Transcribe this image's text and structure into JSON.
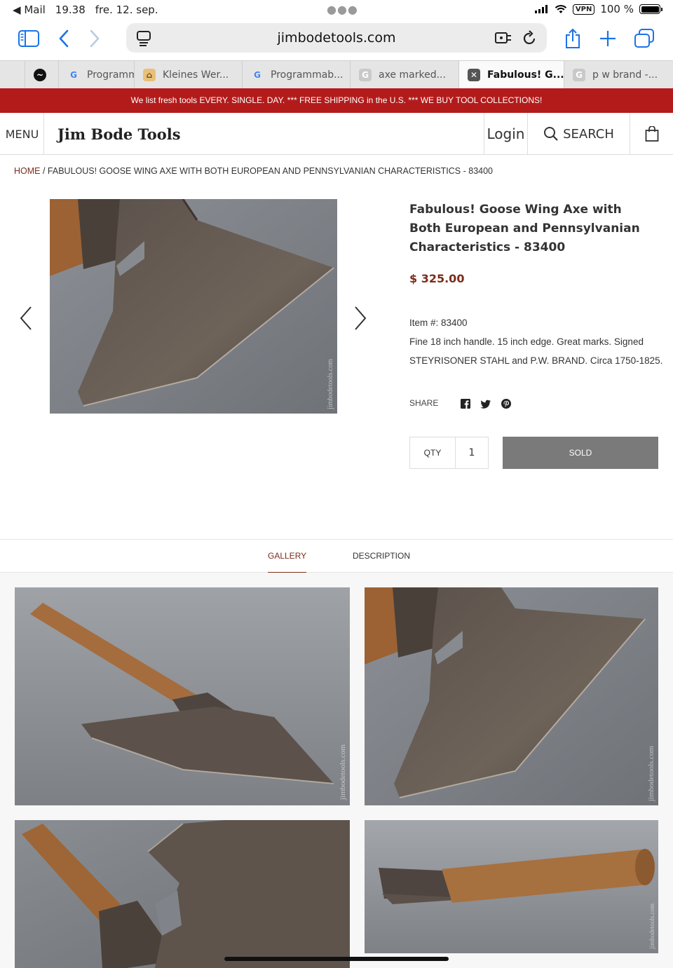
{
  "status_bar": {
    "back_app": "Mail",
    "time": "19.38",
    "date": "fre. 12. sep.",
    "vpn": "VPN",
    "battery": "100 %"
  },
  "browser": {
    "url": "jimbodetools.com",
    "tabs": [
      {
        "label": "",
        "favicon": "circle-logo"
      },
      {
        "label": "Programm",
        "favicon": "google-icon"
      },
      {
        "label": "Kleines Wer...",
        "favicon": "workbench-icon"
      },
      {
        "label": "Programmab...",
        "favicon": "google-icon"
      },
      {
        "label": "axe marked...",
        "favicon": "g-placeholder-icon"
      },
      {
        "label": "Fabulous! G...",
        "favicon": "close-icon"
      },
      {
        "label": "p w brand -...",
        "favicon": "g-placeholder-icon"
      }
    ]
  },
  "promo": {
    "text": "We list fresh tools EVERY. SINGLE. DAY. *** FREE SHIPPING in the U.S. *** WE BUY TOOL COLLECTIONS!"
  },
  "header": {
    "menu": "MENU",
    "logo": "Jim Bode Tools",
    "login": "Login",
    "search": "SEARCH"
  },
  "breadcrumb": {
    "home": "HOME",
    "separator": " / ",
    "current": "FABULOUS! GOOSE WING AXE WITH BOTH EUROPEAN AND PENNSYLVANIAN CHARACTERISTICS - 83400"
  },
  "product": {
    "title": "Fabulous! Goose Wing Axe with Both European and Pennsylvanian Characteristics - 83400",
    "price": "$ 325.00",
    "item_number": "Item #: 83400",
    "description_line1": "Fine 18 inch handle. 15 inch edge. Great marks. Signed",
    "description_line2": "STEYRISONER STAHL and P.W. BRAND. Circa 1750-1825.",
    "share_label": "SHARE",
    "qty_label": "QTY",
    "qty_value": "1",
    "sold_label": "SOLD",
    "watermark": "jimbodetools.com"
  },
  "tabs": {
    "gallery": "GALLERY",
    "description": "DESCRIPTION"
  },
  "colors": {
    "accent": "#7b2d1a",
    "promo_bg": "#b31b1b",
    "sold_bg": "#7a7a7a",
    "ios_blue": "#1a73e8"
  }
}
